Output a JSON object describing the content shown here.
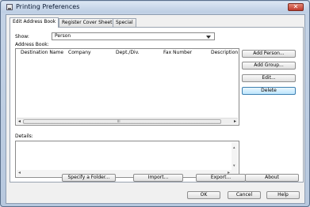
{
  "window": {
    "title": "Printing Preferences",
    "close_label": "✕"
  },
  "tabs": [
    "Edit Address Book",
    "Register Cover Sheet",
    "Special"
  ],
  "show": {
    "label": "Show:",
    "value": "Person"
  },
  "address_book": {
    "label": "Address Book:",
    "columns": [
      "Destination Name",
      "Company",
      "Dept./Div.",
      "Fax Number",
      "Description"
    ]
  },
  "side_buttons": [
    "Add Person...",
    "Add Group...",
    "Edit...",
    "Delete"
  ],
  "details_label": "Details:",
  "bottom_buttons": [
    "Specify a Folder...",
    "Import...",
    "Export...",
    "About"
  ],
  "dialog_buttons": [
    "OK",
    "Cancel",
    "Help"
  ]
}
